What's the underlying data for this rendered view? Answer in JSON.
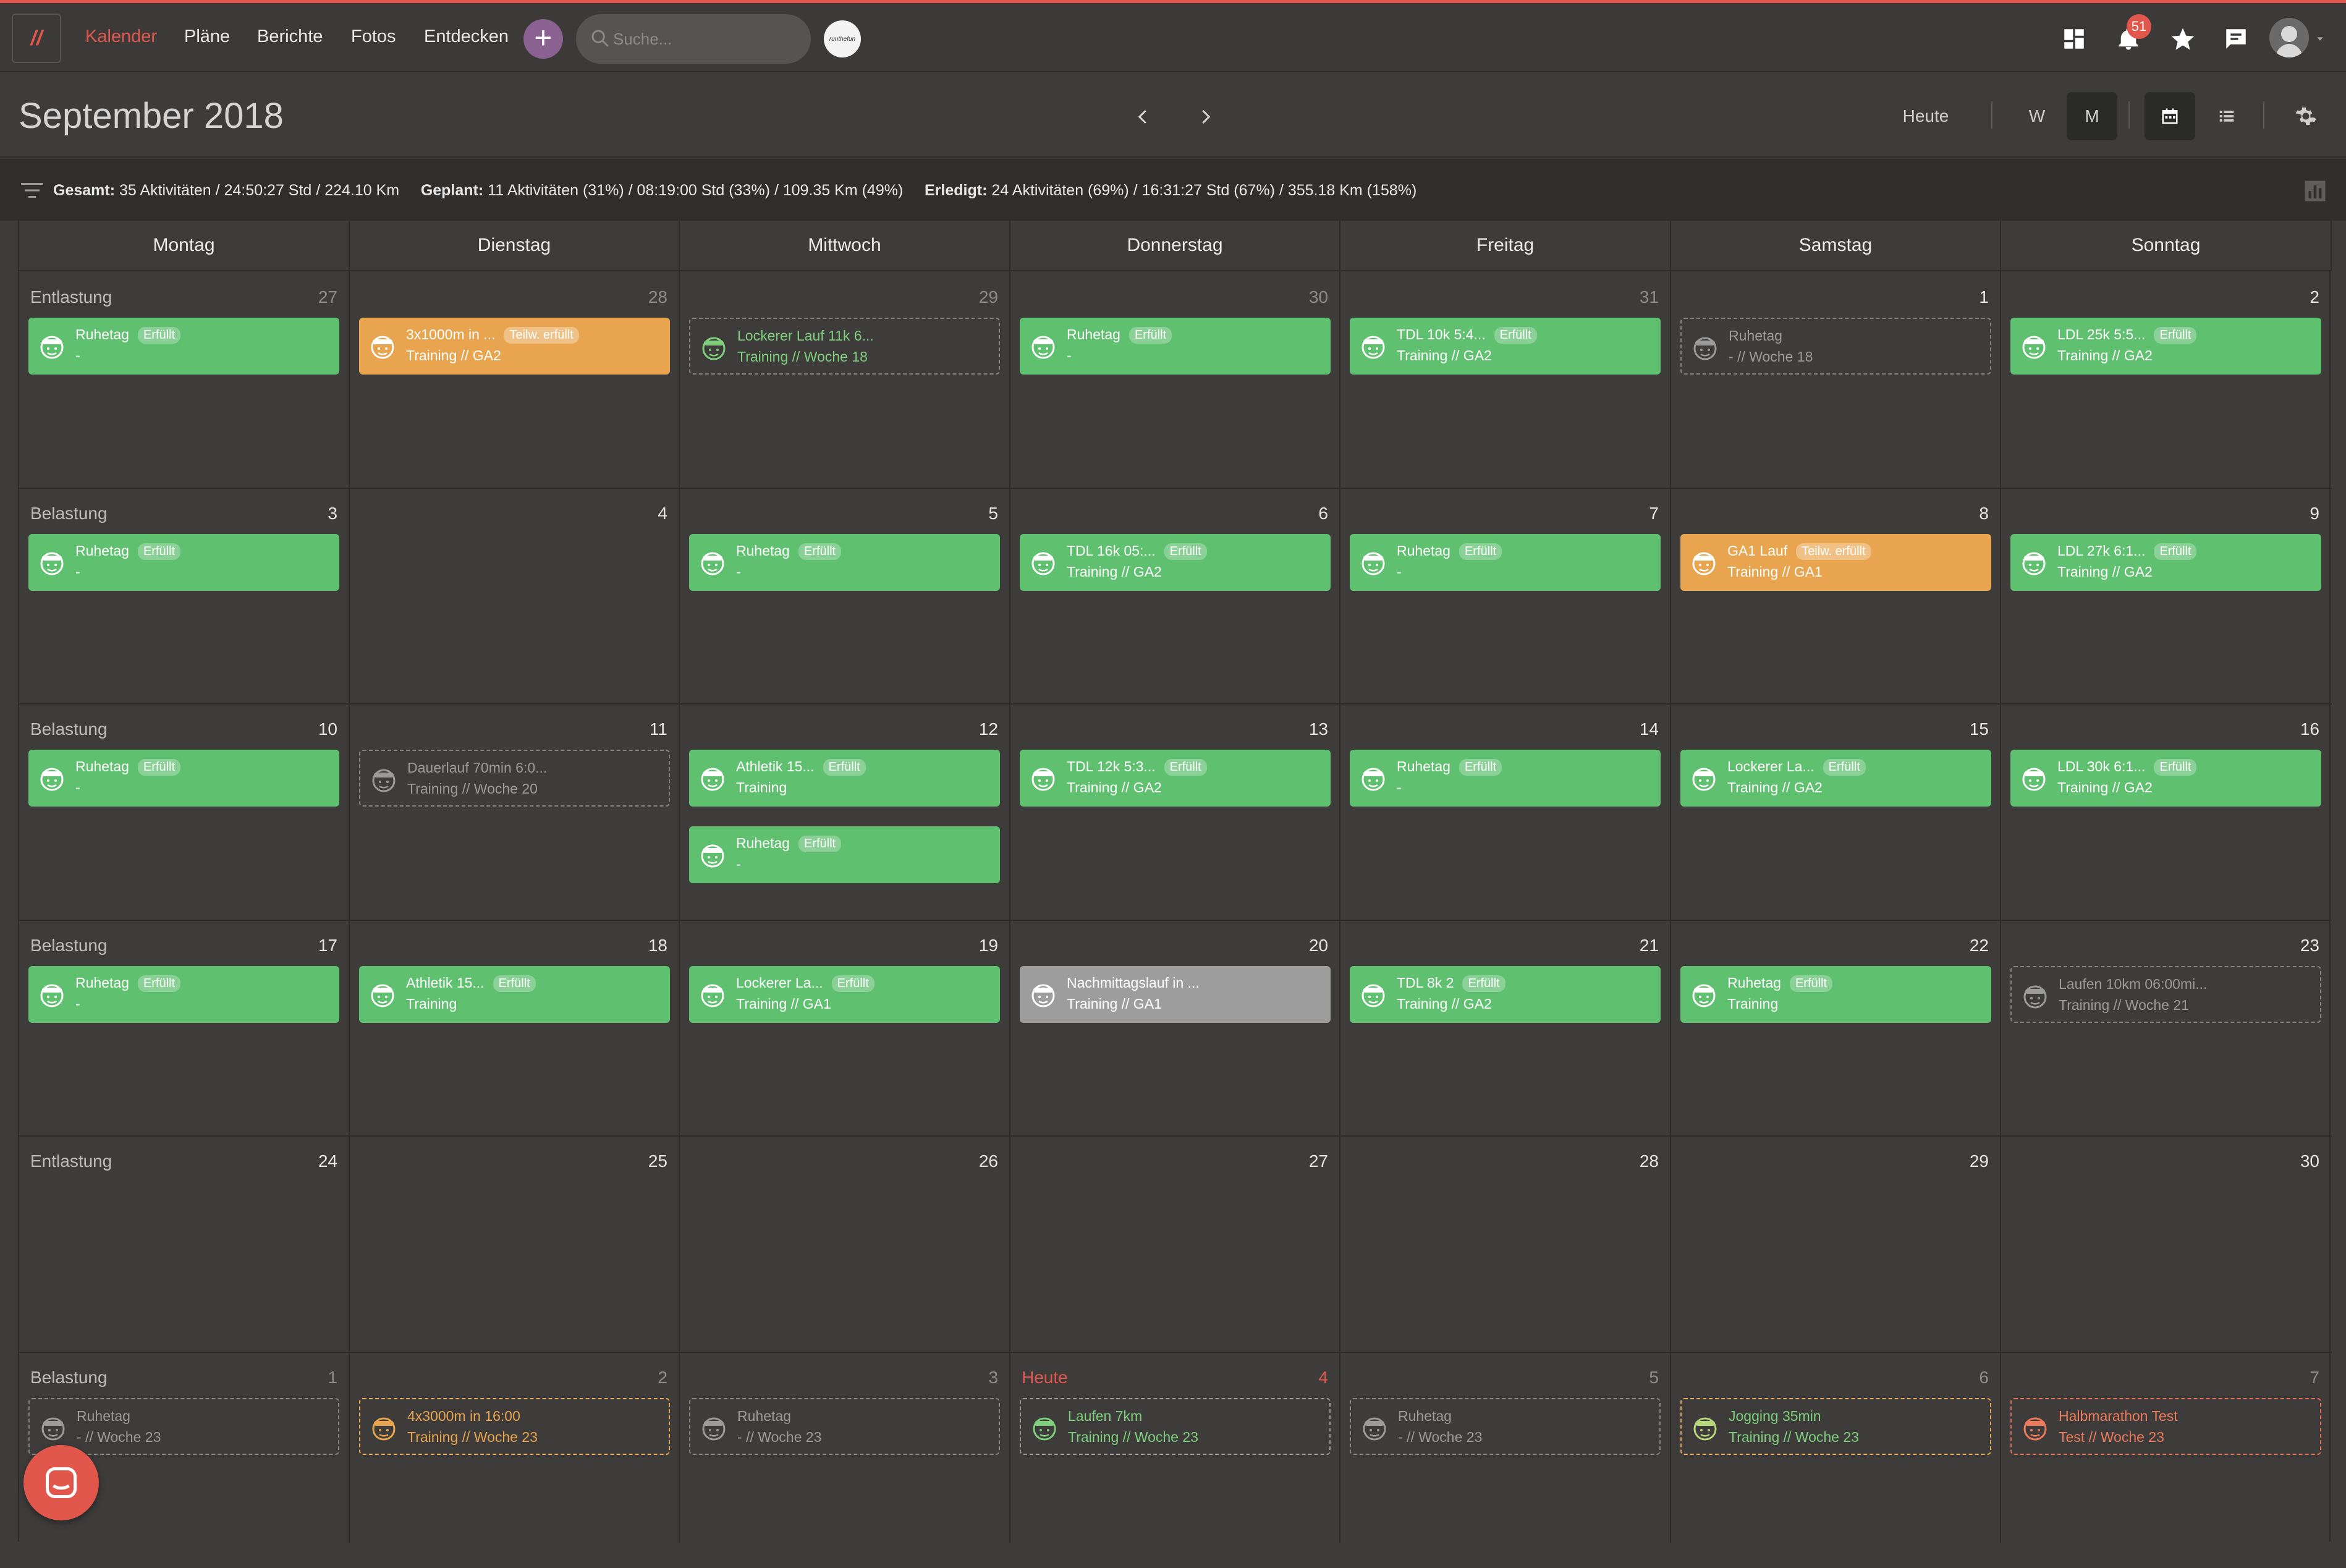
{
  "nav": {
    "logo": "//",
    "links": [
      "Kalender",
      "Pläne",
      "Berichte",
      "Fotos",
      "Entdecken"
    ],
    "plus": "+",
    "search_placeholder": "Suche...",
    "club_logo": "runthefun",
    "notifications_count": "51"
  },
  "header": {
    "month_title": "September 2018",
    "today_btn": "Heute",
    "week_btn": "W",
    "month_btn": "M"
  },
  "summary": {
    "gesamt_label": "Gesamt:",
    "gesamt_value": "35 Aktivitäten / 24:50:27 Std / 224.10 Km",
    "geplant_label": "Geplant:",
    "geplant_value": "11 Aktivitäten (31%) / 08:19:00 Std (33%) / 109.35 Km (49%)",
    "erledigt_label": "Erledigt:",
    "erledigt_value": "24 Aktivitäten (69%) / 16:31:27 Std (67%) / 355.18 Km (158%)"
  },
  "weekdays": [
    "Montag",
    "Dienstag",
    "Mittwoch",
    "Donnerstag",
    "Freitag",
    "Samstag",
    "Sonntag"
  ],
  "weeks": [
    {
      "label": "Entlastung",
      "days": [
        "27",
        "28",
        "29",
        "30",
        "31",
        "1",
        "2"
      ]
    },
    {
      "label": "Belastung",
      "days": [
        "3",
        "4",
        "5",
        "6",
        "7",
        "8",
        "9"
      ]
    },
    {
      "label": "Belastung",
      "days": [
        "10",
        "11",
        "12",
        "13",
        "14",
        "15",
        "16"
      ]
    },
    {
      "label": "Belastung",
      "days": [
        "17",
        "18",
        "19",
        "20",
        "21",
        "22",
        "23"
      ]
    },
    {
      "label": "Entlastung",
      "days": [
        "24",
        "25",
        "26",
        "27",
        "28",
        "29",
        "30"
      ]
    },
    {
      "label": "Belastung",
      "days": [
        "1",
        "2",
        "3",
        "4",
        "5",
        "6",
        "7"
      ]
    }
  ],
  "today_label": "Heute",
  "events": [
    {
      "title": "Ruhetag",
      "badge": "Erfüllt",
      "sub": "-"
    },
    {
      "title": "3x1000m in ...",
      "badge": "Teilw. erfüllt",
      "sub": "Training // GA2"
    },
    {
      "title": "Lockerer Lauf 11k 6...",
      "badge": "",
      "sub": "Training // Woche 18"
    },
    {
      "title": "Ruhetag",
      "badge": "Erfüllt",
      "sub": "-"
    },
    {
      "title": "TDL 10k 5:4...",
      "badge": "Erfüllt",
      "sub": "Training // GA2"
    },
    {
      "title": "Ruhetag",
      "badge": "",
      "sub": "- // Woche 18"
    },
    {
      "title": "LDL 25k 5:5...",
      "badge": "Erfüllt",
      "sub": "Training // GA2"
    },
    {
      "title": "Ruhetag",
      "badge": "Erfüllt",
      "sub": "-"
    },
    {
      "title": "Ruhetag",
      "badge": "Erfüllt",
      "sub": "-"
    },
    {
      "title": "TDL 16k 05:...",
      "badge": "Erfüllt",
      "sub": "Training // GA2"
    },
    {
      "title": "Ruhetag",
      "badge": "Erfüllt",
      "sub": "-"
    },
    {
      "title": "GA1 Lauf",
      "badge": "Teilw. erfüllt",
      "sub": "Training // GA1"
    },
    {
      "title": "LDL 27k 6:1...",
      "badge": "Erfüllt",
      "sub": "Training // GA2"
    },
    {
      "title": "Ruhetag",
      "badge": "Erfüllt",
      "sub": "-"
    },
    {
      "title": "Dauerlauf 70min 6:0...",
      "badge": "",
      "sub": "Training // Woche 20"
    },
    {
      "title": "Athletik 15...",
      "badge": "Erfüllt",
      "sub": "Training"
    },
    {
      "title": "Ruhetag",
      "badge": "Erfüllt",
      "sub": "-"
    },
    {
      "title": "TDL 12k 5:3...",
      "badge": "Erfüllt",
      "sub": "Training // GA2"
    },
    {
      "title": "Ruhetag",
      "badge": "Erfüllt",
      "sub": "-"
    },
    {
      "title": "Lockerer La...",
      "badge": "Erfüllt",
      "sub": "Training // GA2"
    },
    {
      "title": "LDL 30k 6:1...",
      "badge": "Erfüllt",
      "sub": "Training // GA2"
    },
    {
      "title": "Ruhetag",
      "badge": "Erfüllt",
      "sub": "-"
    },
    {
      "title": "Athletik 15...",
      "badge": "Erfüllt",
      "sub": "Training"
    },
    {
      "title": "Lockerer La...",
      "badge": "Erfüllt",
      "sub": "Training // GA1"
    },
    {
      "title": "Nachmittagslauf in ...",
      "badge": "",
      "sub": "Training // GA1"
    },
    {
      "title": "TDL 8k 2",
      "badge": "Erfüllt",
      "sub": "Training // GA2"
    },
    {
      "title": "Ruhetag",
      "badge": "Erfüllt",
      "sub": "Training"
    },
    {
      "title": "Laufen 10km 06:00mi...",
      "badge": "",
      "sub": "Training // Woche 21"
    },
    {
      "title": "Ruhetag",
      "badge": "",
      "sub": "- // Woche 23"
    },
    {
      "title": "4x3000m in 16:00",
      "badge": "",
      "sub": "Training // Woche 23"
    },
    {
      "title": "Ruhetag",
      "badge": "",
      "sub": "- // Woche 23"
    },
    {
      "title": "Laufen 7km",
      "badge": "",
      "sub": "Training // Woche 23"
    },
    {
      "title": "Ruhetag",
      "badge": "",
      "sub": "- // Woche 23"
    },
    {
      "title": "Jogging 35min",
      "badge": "",
      "sub": "Training // Woche 23"
    },
    {
      "title": "Halbmarathon Test",
      "badge": "",
      "sub": "Test // Woche 23"
    }
  ]
}
